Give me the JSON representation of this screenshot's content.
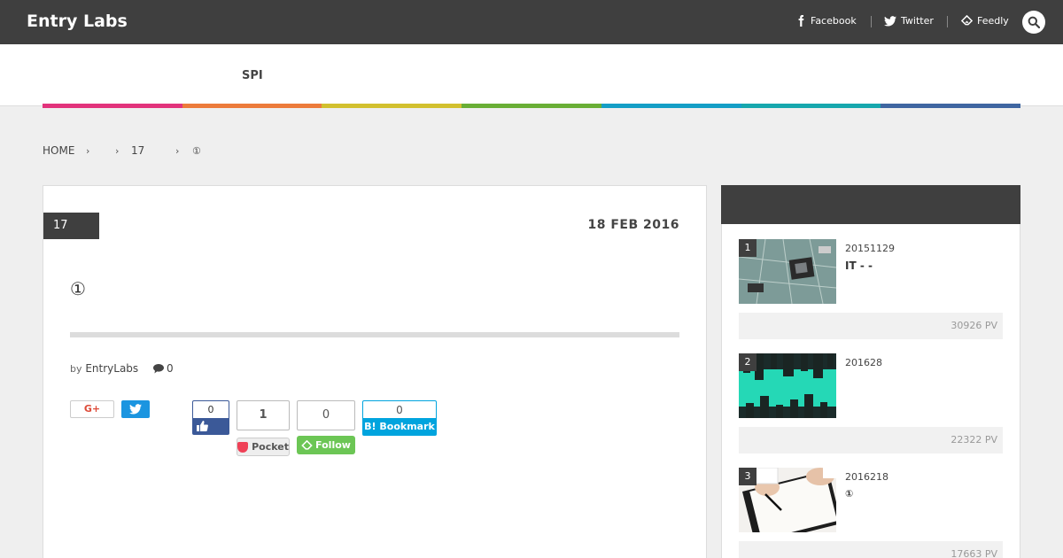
{
  "header": {
    "brand": "Entry Labs",
    "social": [
      {
        "label": "Facebook",
        "icon": "facebook-icon"
      },
      {
        "label": "Twitter",
        "icon": "twitter-icon"
      },
      {
        "label": "Feedly",
        "icon": "feedly-icon"
      }
    ],
    "search_icon": "search-icon"
  },
  "nav": {
    "items": [
      "SPI"
    ]
  },
  "colorbar": [
    "#e2337c",
    "#ec7b3b",
    "#d2c02e",
    "#69ae35",
    "#149ec6",
    "#16a7ad",
    "#3f66a1"
  ],
  "breadcrumb": [
    "HOME",
    "",
    "17",
    "①"
  ],
  "post": {
    "category": "17",
    "date": "18 FEB 2016",
    "title": "①",
    "by": "by",
    "author": "EntryLabs",
    "comments": "0"
  },
  "share": {
    "gplus": "G+",
    "facebook_count": "0",
    "pocket_count": "1",
    "pocket_label": "Pocket",
    "feedly_count": "0",
    "feedly_label": "Follow",
    "hatena_count": "0",
    "hatena_label": "B! Bookmark"
  },
  "ranking": [
    {
      "rank": "1",
      "date": "20151129",
      "title": "IT - -",
      "pv": "30926 PV"
    },
    {
      "rank": "2",
      "date": "201628",
      "title": "",
      "pv": "22322 PV"
    },
    {
      "rank": "3",
      "date": "2016218",
      "title": "①",
      "pv": "17663 PV"
    }
  ]
}
